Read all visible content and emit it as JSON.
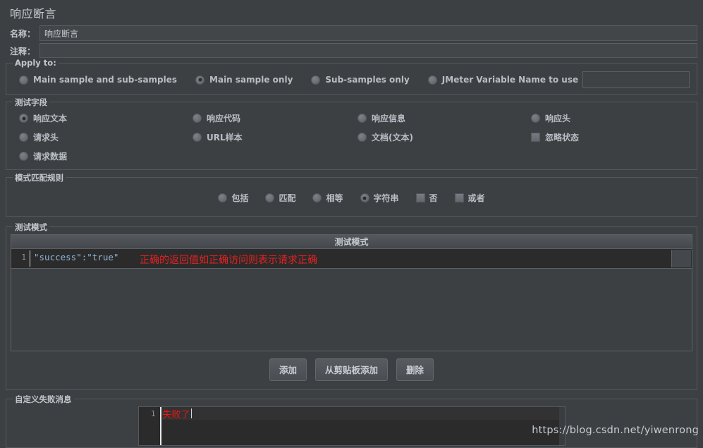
{
  "window": {
    "title": "响应断言"
  },
  "fields": {
    "name_label": "名称：",
    "name_value": "响应断言",
    "comment_label": "注释：",
    "comment_value": ""
  },
  "apply_to": {
    "group_title": "Apply to:",
    "options": [
      {
        "label": "Main sample and sub-samples",
        "selected": false
      },
      {
        "label": "Main sample only",
        "selected": true
      },
      {
        "label": "Sub-samples only",
        "selected": false
      },
      {
        "label": "JMeter Variable Name to use",
        "selected": false
      }
    ],
    "variable_value": ""
  },
  "test_field": {
    "group_title": "测试字段",
    "options": [
      {
        "label": "响应文本",
        "type": "radio",
        "selected": true
      },
      {
        "label": "响应代码",
        "type": "radio",
        "selected": false
      },
      {
        "label": "响应信息",
        "type": "radio",
        "selected": false
      },
      {
        "label": "响应头",
        "type": "radio",
        "selected": false
      },
      {
        "label": "请求头",
        "type": "radio",
        "selected": false
      },
      {
        "label": "URL样本",
        "type": "radio",
        "selected": false
      },
      {
        "label": "文档(文本)",
        "type": "radio",
        "selected": false
      },
      {
        "label": "忽略状态",
        "type": "checkbox",
        "selected": false
      },
      {
        "label": "请求数据",
        "type": "radio",
        "selected": false
      }
    ]
  },
  "pattern_rules": {
    "group_title": "模式匹配规则",
    "options": [
      {
        "label": "包括",
        "type": "radio",
        "selected": false
      },
      {
        "label": "匹配",
        "type": "radio",
        "selected": false
      },
      {
        "label": "相等",
        "type": "radio",
        "selected": false
      },
      {
        "label": "字符串",
        "type": "radio",
        "selected": true
      },
      {
        "label": "否",
        "type": "checkbox",
        "selected": false
      },
      {
        "label": "或者",
        "type": "checkbox",
        "selected": false
      }
    ]
  },
  "test_patterns": {
    "group_title": "测试模式",
    "column_header": "测试模式",
    "rows": [
      {
        "line_no": "1",
        "value": "\"success\":\"true\""
      }
    ],
    "annotation": "正确的返回值如正确访问则表示请求正确",
    "buttons": {
      "add": "添加",
      "add_from_clipboard": "从剪贴板添加",
      "delete": "删除"
    }
  },
  "custom_fail_message": {
    "group_title": "自定义失败消息",
    "line_no": "1",
    "value": "失败了"
  },
  "watermark": "https://blog.csdn.net/yiwenrong",
  "colors": {
    "background": "#3c4043",
    "editor_background": "#2b2b2b",
    "annotation_red": "#e82020",
    "fail_text_red": "#ef1414",
    "code_blue": "#8fb6d8",
    "text": "#b8bdc4"
  }
}
